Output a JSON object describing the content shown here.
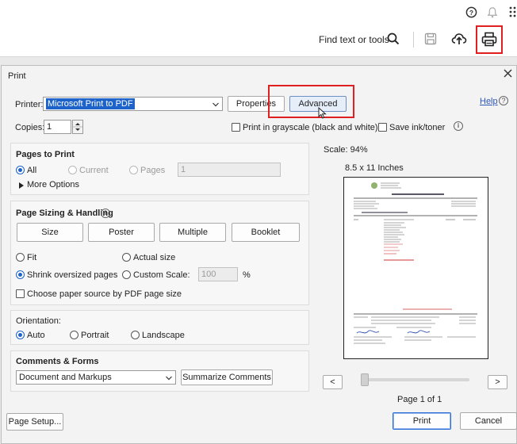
{
  "app": {
    "find_text": "Find text or tools"
  },
  "dialog": {
    "title": "Print",
    "printer_label": "Printer:",
    "printer_value": "Microsoft Print to PDF",
    "properties_label": "Properties",
    "advanced_label": "Advanced",
    "help_label": "Help",
    "copies_label": "Copies:",
    "copies_value": "1",
    "grayscale_label": "Print in grayscale (black and white)",
    "save_ink_label": "Save ink/toner",
    "pages_to_print": {
      "title": "Pages to Print",
      "all": "All",
      "current": "Current",
      "pages": "Pages",
      "pages_value": "1",
      "more_options": "More Options"
    },
    "sizing": {
      "title": "Page Sizing & Handling",
      "tabs": [
        "Size",
        "Poster",
        "Multiple",
        "Booklet"
      ],
      "fit": "Fit",
      "actual_size": "Actual size",
      "shrink": "Shrink oversized pages",
      "custom_scale": "Custom Scale:",
      "custom_scale_value": "100",
      "percent": "%",
      "paper_source": "Choose paper source by PDF page size"
    },
    "orientation": {
      "title": "Orientation:",
      "auto": "Auto",
      "portrait": "Portrait",
      "landscape": "Landscape"
    },
    "comments": {
      "title": "Comments & Forms",
      "value": "Document and Markups",
      "summarize": "Summarize Comments"
    },
    "preview": {
      "scale": "Scale:  94%",
      "paper": "8.5 x 11 Inches",
      "prev": "<",
      "next": ">",
      "page_info": "Page 1 of 1"
    },
    "page_setup": "Page Setup...",
    "print": "Print",
    "cancel": "Cancel"
  },
  "colors": {
    "accent": "#1e63c9",
    "highlight": "#e02020"
  }
}
